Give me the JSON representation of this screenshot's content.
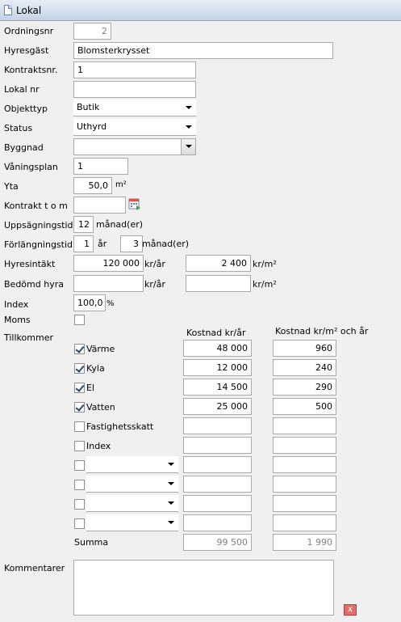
{
  "window": {
    "title": "Lokal"
  },
  "form": {
    "ordningsnr": {
      "label": "Ordningsnr",
      "value": "2"
    },
    "hyresgast": {
      "label": "Hyresgäst",
      "value": "Blomsterkrysset"
    },
    "kontraktsnr": {
      "label": "Kontraktsnr.",
      "value": "1"
    },
    "lokalnr": {
      "label": "Lokal nr",
      "value": ""
    },
    "objekttyp": {
      "label": "Objekttyp",
      "value": "Butik"
    },
    "status": {
      "label": "Status",
      "value": "Uthyrd"
    },
    "byggnad": {
      "label": "Byggnad",
      "value": ""
    },
    "vaningsplan": {
      "label": "Våningsplan",
      "value": "1"
    },
    "yta": {
      "label": "Yta",
      "value": "50,0",
      "unit": "m²"
    },
    "kontrakt_tom": {
      "label": "Kontrakt t o m",
      "value": ""
    },
    "uppsagningstid": {
      "label": "Uppsägningstid",
      "value": "12",
      "unit": "månad(er)"
    },
    "forlangningstid": {
      "label": "Förlängningstid",
      "years": "1",
      "years_unit": "år",
      "months": "3",
      "months_unit": "månad(er)"
    },
    "hyresintakt": {
      "label": "Hyresintäkt",
      "value": "120 000",
      "unit": "kr/år",
      "per_m2": "2 400",
      "per_m2_unit": "kr/m²"
    },
    "bedomd_hyra": {
      "label": "Bedömd hyra",
      "value": "",
      "unit": "kr/år",
      "per_m2": "",
      "per_m2_unit": "kr/m²"
    },
    "index": {
      "label": "Index",
      "value": "100,0",
      "unit": "%"
    },
    "moms": {
      "label": "Moms",
      "checked": false
    },
    "tillkommer": {
      "label": "Tillkommer",
      "col1_header": "Kostnad kr/år",
      "col2_header": "Kostnad kr/m² och år",
      "rows": [
        {
          "name": "Värme",
          "checked": true,
          "cost": "48 000",
          "per_m2": "960"
        },
        {
          "name": "Kyla",
          "checked": true,
          "cost": "12 000",
          "per_m2": "240"
        },
        {
          "name": "El",
          "checked": true,
          "cost": "14 500",
          "per_m2": "290"
        },
        {
          "name": "Vatten",
          "checked": true,
          "cost": "25 000",
          "per_m2": "500"
        },
        {
          "name": "Fastighetsskatt",
          "checked": false,
          "cost": "",
          "per_m2": ""
        },
        {
          "name": "Index",
          "checked": false,
          "cost": "",
          "per_m2": ""
        }
      ],
      "custom_rows": [
        {
          "checked": false,
          "selected": "",
          "cost": "",
          "per_m2": ""
        },
        {
          "checked": false,
          "selected": "",
          "cost": "",
          "per_m2": ""
        },
        {
          "checked": false,
          "selected": "",
          "cost": "",
          "per_m2": ""
        },
        {
          "checked": false,
          "selected": "",
          "cost": "",
          "per_m2": ""
        }
      ],
      "summa_label": "Summa",
      "summa_cost": "99 500",
      "summa_per_m2": "1 990"
    },
    "kommentarer": {
      "label": "Kommentarer",
      "value": ""
    }
  },
  "icons": {
    "calendar": "calendar-icon",
    "delete": "delete-icon",
    "delete_glyph": "x"
  }
}
